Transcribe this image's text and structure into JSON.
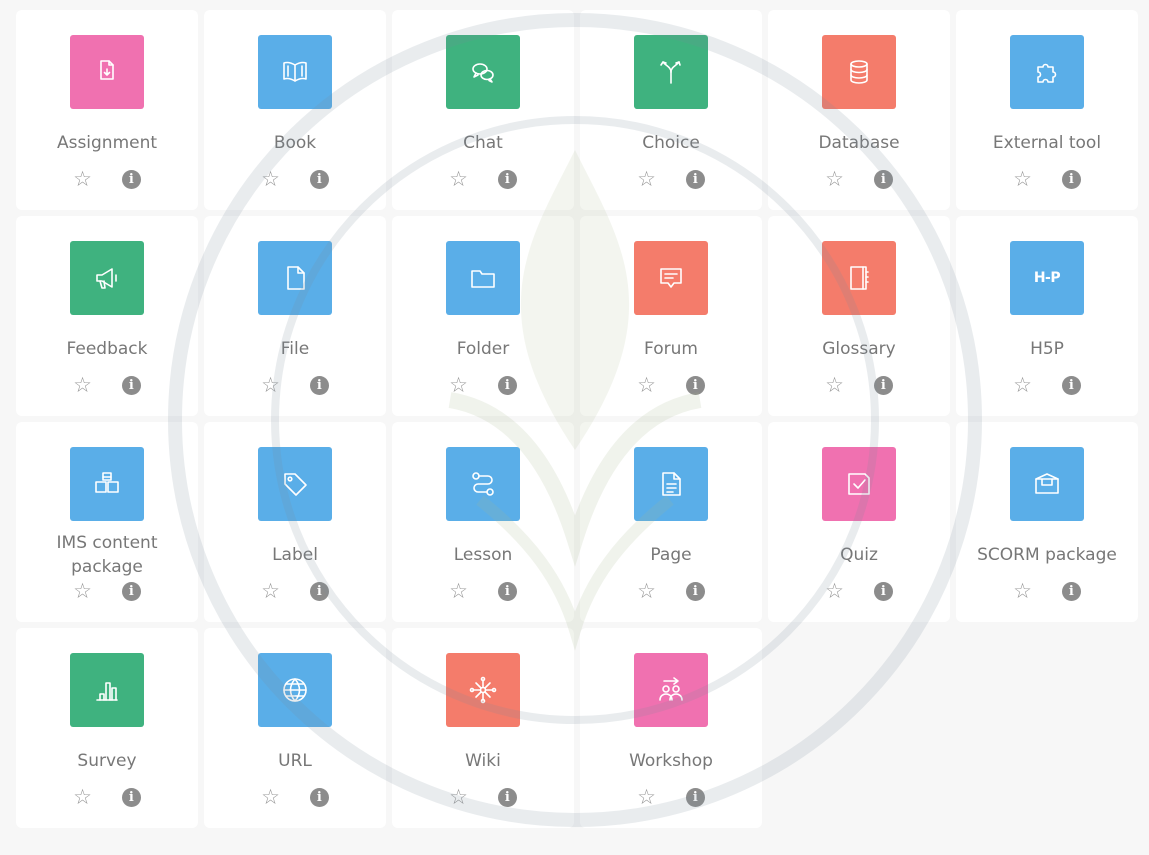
{
  "colors": {
    "pink": "#f071b0",
    "blue": "#5aaee8",
    "green": "#3fb27f",
    "orange": "#f47c6b"
  },
  "modules": [
    {
      "name": "Assignment",
      "icon": "assignment-icon",
      "color": "pink"
    },
    {
      "name": "Book",
      "icon": "book-icon",
      "color": "blue"
    },
    {
      "name": "Chat",
      "icon": "chat-icon",
      "color": "green"
    },
    {
      "name": "Choice",
      "icon": "choice-icon",
      "color": "green"
    },
    {
      "name": "Database",
      "icon": "database-icon",
      "color": "orange"
    },
    {
      "name": "External tool",
      "icon": "puzzle-icon",
      "color": "blue"
    },
    {
      "name": "Feedback",
      "icon": "megaphone-icon",
      "color": "green"
    },
    {
      "name": "File",
      "icon": "file-icon",
      "color": "blue"
    },
    {
      "name": "Folder",
      "icon": "folder-icon",
      "color": "blue"
    },
    {
      "name": "Forum",
      "icon": "forum-icon",
      "color": "orange"
    },
    {
      "name": "Glossary",
      "icon": "glossary-icon",
      "color": "orange"
    },
    {
      "name": "H5P",
      "icon": "h5p-icon",
      "color": "blue",
      "icon_text": "H-P"
    },
    {
      "name": "IMS content package",
      "icon": "ims-package-icon",
      "color": "blue"
    },
    {
      "name": "Label",
      "icon": "tag-icon",
      "color": "blue"
    },
    {
      "name": "Lesson",
      "icon": "lesson-icon",
      "color": "blue"
    },
    {
      "name": "Page",
      "icon": "page-icon",
      "color": "blue"
    },
    {
      "name": "Quiz",
      "icon": "quiz-icon",
      "color": "pink"
    },
    {
      "name": "SCORM package",
      "icon": "scorm-icon",
      "color": "blue"
    },
    {
      "name": "Survey",
      "icon": "survey-icon",
      "color": "green"
    },
    {
      "name": "URL",
      "icon": "globe-icon",
      "color": "blue"
    },
    {
      "name": "Wiki",
      "icon": "wiki-icon",
      "color": "orange"
    },
    {
      "name": "Workshop",
      "icon": "workshop-icon",
      "color": "pink"
    }
  ],
  "actions": {
    "star_glyph": "☆",
    "info_glyph": "i"
  }
}
